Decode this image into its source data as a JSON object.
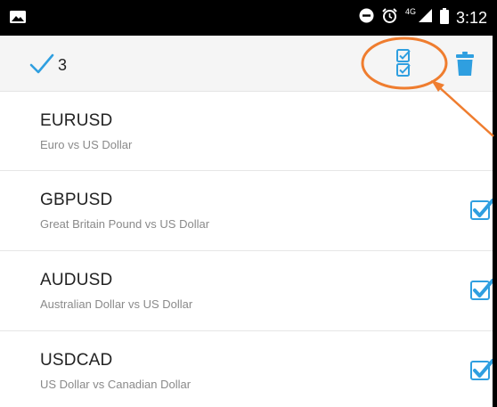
{
  "status_bar": {
    "time": "3:12",
    "network": "4G",
    "icons": [
      "image-icon",
      "do-not-disturb-icon",
      "alarm-icon",
      "signal-icon",
      "battery-icon"
    ]
  },
  "toolbar": {
    "selected_count": "3",
    "icons": [
      "checkmark-icon",
      "select-all-icon",
      "trash-icon"
    ]
  },
  "symbols": [
    {
      "name": "EURUSD",
      "description": "Euro vs US Dollar",
      "checked": false
    },
    {
      "name": "GBPUSD",
      "description": "Great Britain Pound vs US Dollar",
      "checked": true
    },
    {
      "name": "AUDUSD",
      "description": "Australian Dollar vs US Dollar",
      "checked": true
    },
    {
      "name": "USDCAD",
      "description": "US Dollar vs Canadian Dollar",
      "checked": true
    }
  ],
  "colors": {
    "accent": "#2f9fe0",
    "annotation": "#ef7d2f",
    "status_bar": "#000000",
    "toolbar_bg": "#f5f5f5"
  }
}
